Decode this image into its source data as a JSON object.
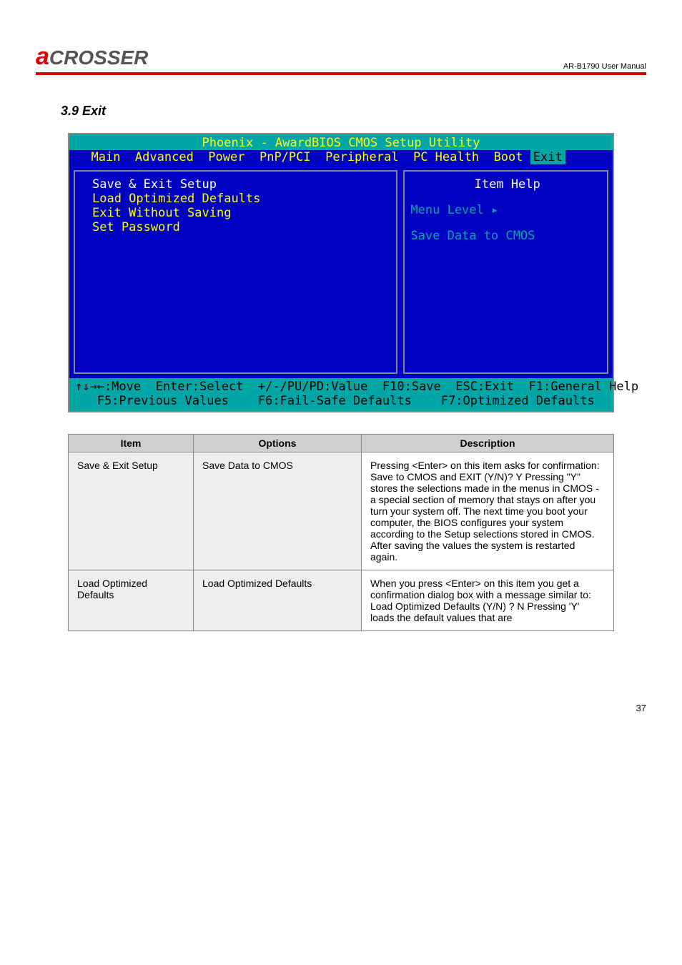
{
  "doc_title": "AR-B1790 User Manual",
  "section_title": "3.9 Exit",
  "bios": {
    "title": "Phoenix - AwardBIOS CMOS Setup Utility",
    "tabs": [
      "Main",
      "Advanced",
      "Power",
      "PnP/PCI",
      "Peripheral",
      "PC Health",
      "Boot",
      "Exit"
    ],
    "menu_items": [
      "Save & Exit Setup",
      "Load Optimized Defaults",
      "Exit Without Saving",
      "Set Password"
    ],
    "help_title": "Item Help",
    "menu_level": "Menu Level   ▸",
    "help_text": "Save Data to CMOS",
    "footer1": "↑↓→←:Move  Enter:Select  +/-/PU/PD:Value  F10:Save  ESC:Exit  F1:General Help",
    "footer2": "   F5:Previous Values    F6:Fail-Safe Defaults    F7:Optimized Defaults"
  },
  "table": {
    "headers": [
      "Item",
      "Options",
      "Description"
    ],
    "rows": [
      {
        "item": "Save & Exit Setup",
        "options": "Save Data to CMOS",
        "desc": "Pressing <Enter> on this item asks for confirmation:\nSave to CMOS and EXIT (Y/N)? Y\nPressing \"Y\" stores the selections made in the menus in CMOS - a special section of memory that stays on after you turn your system off. The next time you boot your computer, the BIOS configures your system according to the Setup selections stored in CMOS. After saving the values the system is restarted again."
      },
      {
        "item": "Load Optimized Defaults",
        "options": "Load Optimized Defaults",
        "desc": "When you press <Enter> on this item you get a confirmation dialog box with a message similar to:\nLoad Optimized Defaults (Y/N) ? N\nPressing 'Y' loads the default values that are"
      }
    ]
  },
  "page_num": "37"
}
